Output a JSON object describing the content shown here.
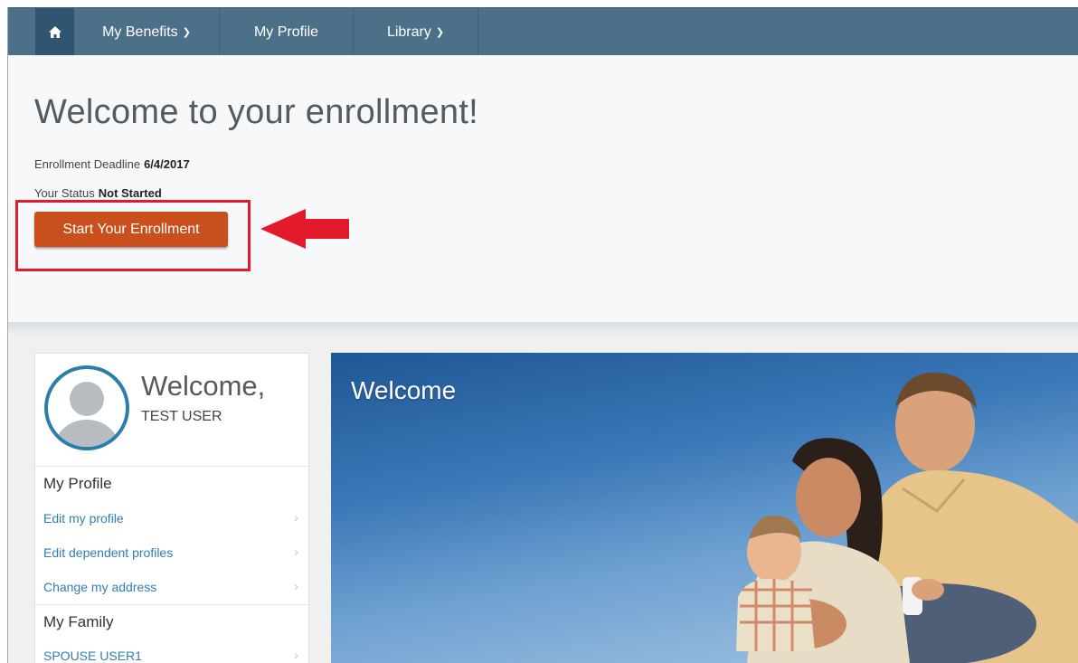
{
  "nav": {
    "home_icon": "home-icon",
    "items": [
      {
        "label": "My Benefits",
        "has_dropdown": true
      },
      {
        "label": "My Profile",
        "has_dropdown": false
      },
      {
        "label": "Library",
        "has_dropdown": true
      }
    ],
    "dropdown_icon": "chevron-down-icon"
  },
  "hero": {
    "title": "Welcome to your enrollment!",
    "deadline_label": "Enrollment Deadline",
    "deadline_value": "6/4/2017",
    "status_label": "Your Status",
    "status_value": "Not Started",
    "start_button": "Start Your Enrollment",
    "annotation_color": "#e21a2a"
  },
  "profile_card": {
    "welcome": "Welcome,",
    "name": "TEST USER",
    "avatar_icon": "user-avatar-icon",
    "sections": [
      {
        "heading": "My Profile",
        "links": [
          "Edit my profile",
          "Edit dependent profiles",
          "Change my address"
        ]
      },
      {
        "heading": "My Family",
        "links": [
          "SPOUSE USER1"
        ]
      }
    ]
  },
  "banner": {
    "title": "Welcome"
  },
  "colors": {
    "nav_bg": "#4d7089",
    "nav_active": "#2f5570",
    "button": "#c9501c",
    "link": "#2f7fb1",
    "avatar_ring": "#2a7ea8"
  }
}
